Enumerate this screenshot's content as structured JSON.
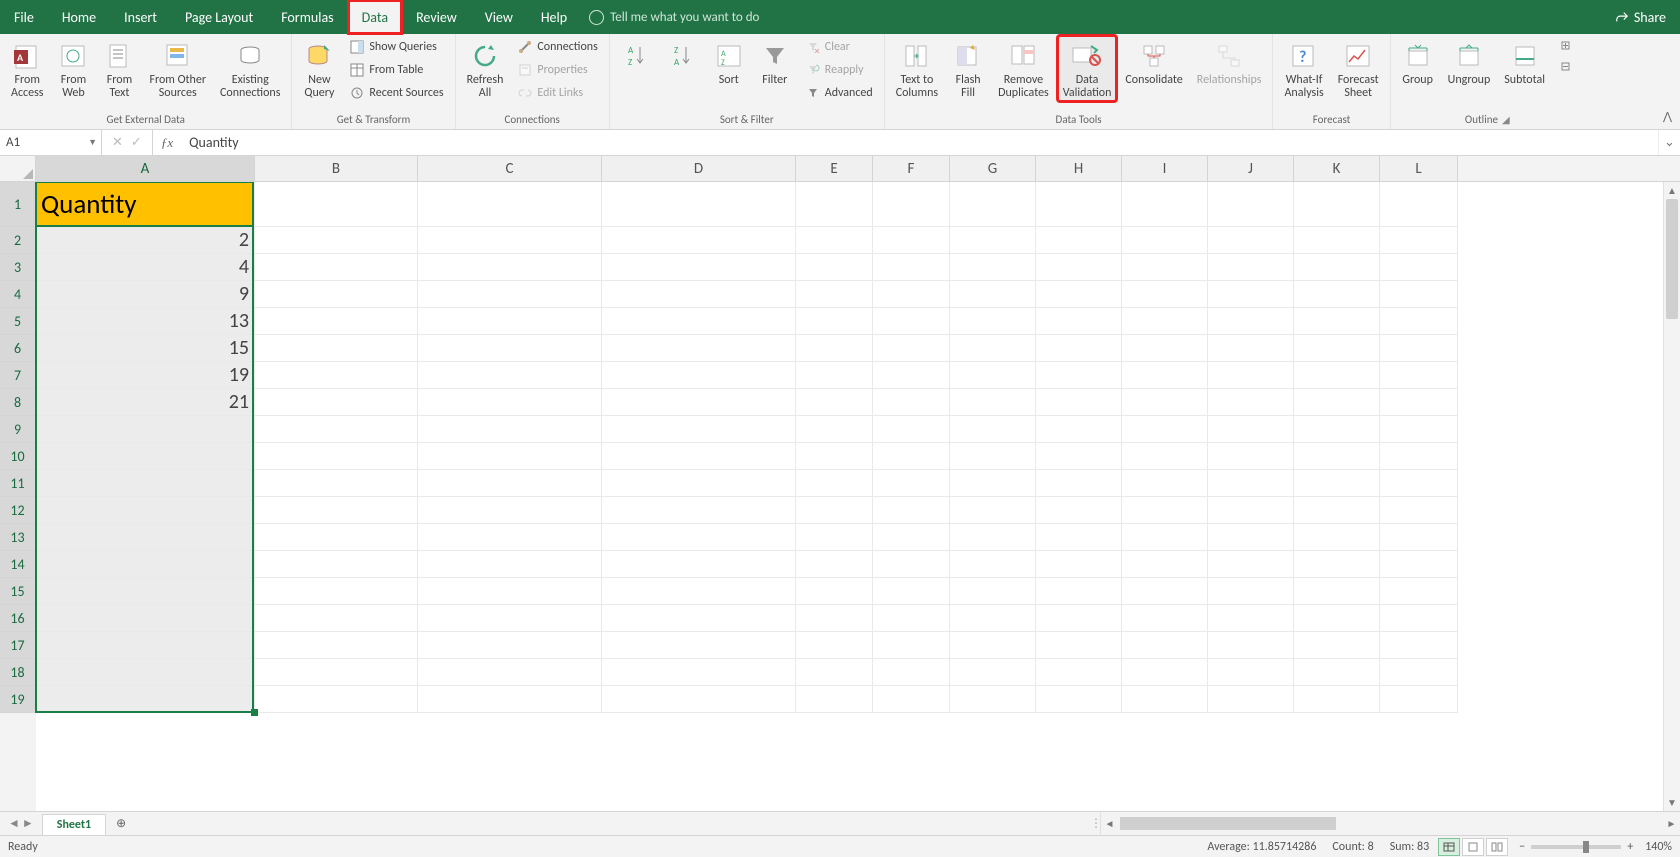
{
  "menu": {
    "tabs": [
      "File",
      "Home",
      "Insert",
      "Page Layout",
      "Formulas",
      "Data",
      "Review",
      "View",
      "Help"
    ],
    "active": "Data",
    "highlighted": "Data",
    "tell_me": "Tell me what you want to do",
    "share": "Share"
  },
  "ribbon": {
    "groups": {
      "get_external": {
        "label": "Get External Data",
        "from_access": "From\nAccess",
        "from_web": "From\nWeb",
        "from_text": "From\nText",
        "from_other": "From Other\nSources",
        "existing": "Existing\nConnections"
      },
      "get_transform": {
        "label": "Get & Transform",
        "new_query": "New\nQuery",
        "show_queries": "Show Queries",
        "from_table": "From Table",
        "recent_sources": "Recent Sources"
      },
      "connections": {
        "label": "Connections",
        "refresh_all": "Refresh\nAll",
        "connections": "Connections",
        "properties": "Properties",
        "edit_links": "Edit Links"
      },
      "sort_filter": {
        "label": "Sort & Filter",
        "sort": "Sort",
        "filter": "Filter",
        "clear": "Clear",
        "reapply": "Reapply",
        "advanced": "Advanced"
      },
      "data_tools": {
        "label": "Data Tools",
        "text_to_columns": "Text to\nColumns",
        "flash_fill": "Flash\nFill",
        "remove_duplicates": "Remove\nDuplicates",
        "data_validation": "Data\nValidation",
        "consolidate": "Consolidate",
        "relationships": "Relationships"
      },
      "forecast": {
        "label": "Forecast",
        "what_if": "What-If\nAnalysis",
        "forecast_sheet": "Forecast\nSheet"
      },
      "outline": {
        "label": "Outline",
        "group": "Group",
        "ungroup": "Ungroup",
        "subtotal": "Subtotal"
      }
    }
  },
  "namebox": "A1",
  "formula": "Quantity",
  "grid": {
    "col_widths": {
      "A": 219
    },
    "default_col_width": 87,
    "columns": [
      "A",
      "B",
      "C",
      "D",
      "E",
      "F",
      "G",
      "H",
      "I",
      "J",
      "K",
      "L"
    ],
    "special_col_widths": {
      "B": 163,
      "C": 184,
      "D": 194,
      "E": 77,
      "F": 77,
      "G": 86,
      "H": 86,
      "I": 86,
      "J": 86,
      "K": 86,
      "L": 78
    },
    "row_heights": {
      "1": 45
    },
    "default_row_height": 27,
    "rows": 19,
    "selected_col": "A",
    "active_cell": "A1",
    "data": {
      "A1": "Quantity",
      "A2": "2",
      "A3": "4",
      "A4": "9",
      "A5": "13",
      "A6": "15",
      "A7": "19",
      "A8": "21"
    }
  },
  "sheets": {
    "active": "Sheet1"
  },
  "status": {
    "ready": "Ready",
    "average_label": "Average:",
    "average": "11.85714286",
    "count_label": "Count:",
    "count": "8",
    "sum_label": "Sum:",
    "sum": "83",
    "zoom": "140%"
  }
}
